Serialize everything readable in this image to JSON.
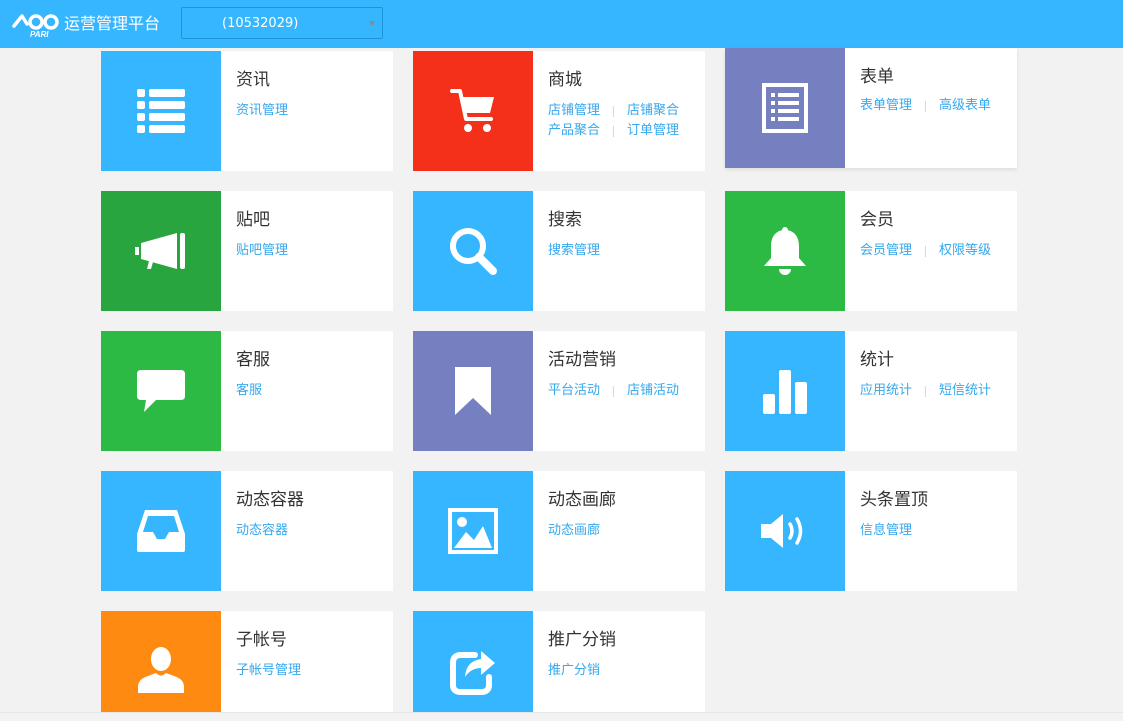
{
  "header": {
    "logo_text": "PARI",
    "platform_name": "运营管理平台",
    "account_select": {
      "value": "(10532029)"
    }
  },
  "colors": {
    "topbar": "#35b6ff",
    "blue": "#35b6ff",
    "red": "#f5301a",
    "purple": "#7680c0",
    "dark_green": "#28a53f",
    "green": "#2dba44",
    "orange": "#ff8a12",
    "link": "#35a8ee"
  },
  "tiles": [
    {
      "title": "资讯",
      "icon": "list-icon",
      "links": [
        [
          "资讯管理"
        ]
      ]
    },
    {
      "title": "商城",
      "icon": "shopping-cart-icon",
      "links": [
        [
          "店铺管理",
          "店铺聚合"
        ],
        [
          "产品聚合",
          "订单管理"
        ]
      ]
    },
    {
      "title": "表单",
      "icon": "form-icon",
      "links": [
        [
          "表单管理",
          "高级表单"
        ]
      ]
    },
    {
      "title": "贴吧",
      "icon": "megaphone-icon",
      "links": [
        [
          "贴吧管理"
        ]
      ]
    },
    {
      "title": "搜索",
      "icon": "search-icon",
      "links": [
        [
          "搜索管理"
        ]
      ]
    },
    {
      "title": "会员",
      "icon": "bell-icon",
      "links": [
        [
          "会员管理",
          "权限等级"
        ]
      ]
    },
    {
      "title": "客服",
      "icon": "chat-bubble-icon",
      "links": [
        [
          "客服"
        ]
      ]
    },
    {
      "title": "活动营销",
      "icon": "bookmark-icon",
      "links": [
        [
          "平台活动",
          "店铺活动"
        ]
      ]
    },
    {
      "title": "统计",
      "icon": "bar-chart-icon",
      "links": [
        [
          "应用统计",
          "短信统计"
        ]
      ]
    },
    {
      "title": "动态容器",
      "icon": "inbox-tray-icon",
      "links": [
        [
          "动态容器"
        ]
      ]
    },
    {
      "title": "动态画廊",
      "icon": "picture-icon",
      "links": [
        [
          "动态画廊"
        ]
      ]
    },
    {
      "title": "头条置顶",
      "icon": "volume-icon",
      "links": [
        [
          "信息管理"
        ]
      ]
    },
    {
      "title": "子帐号",
      "icon": "user-icon",
      "links": [
        [
          "子帐号管理"
        ]
      ]
    },
    {
      "title": "推广分销",
      "icon": "share-icon",
      "links": [
        [
          "推广分销"
        ]
      ]
    }
  ]
}
